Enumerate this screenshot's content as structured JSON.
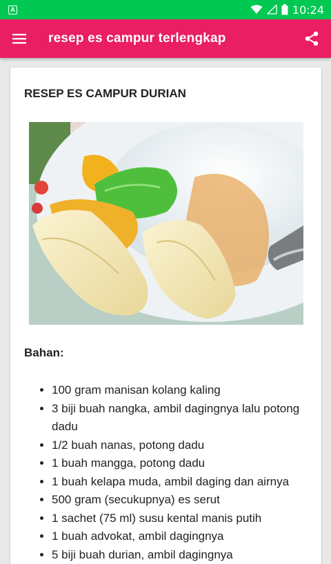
{
  "status_bar": {
    "notification_icon": "A",
    "time": "10:24"
  },
  "app_bar": {
    "title": "resep es campur terlengkap",
    "menu_icon": "hamburger-menu-icon",
    "share_icon": "share-icon",
    "color": "#e91e63"
  },
  "recipe": {
    "title": "RESEP ES CAMPUR DURIAN",
    "image_description": "es campur durian",
    "ingredients_heading": "Bahan:",
    "ingredients": [
      "100 gram manisan kolang kaling",
      "3 biji buah nangka, ambil dagingnya lalu potong dadu",
      "1/2 buah nanas, potong dadu",
      "1 buah mangga, potong dadu",
      "1 buah kelapa muda, ambil daging dan airnya",
      "500 gram (secukupnya) es serut",
      "1 sachet (75 ml) susu kental manis putih",
      "1 buah advokat, ambil dagingnya",
      "5 biji buah durian, ambil dagingnya"
    ]
  }
}
